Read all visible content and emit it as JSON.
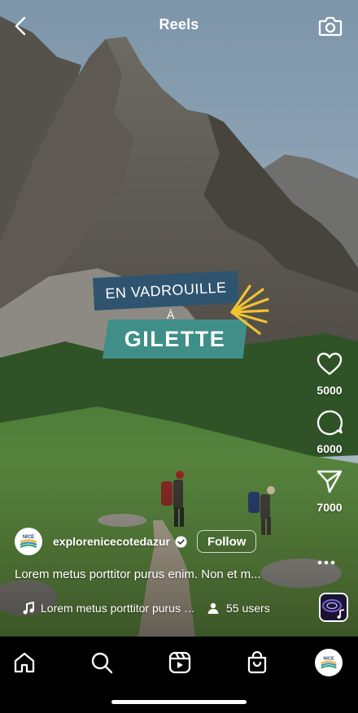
{
  "header": {
    "title": "Reels",
    "back_icon": "chevron-left-icon",
    "camera_icon": "camera-icon"
  },
  "banner": {
    "line1": "EN VADROUILLE",
    "line2": "À",
    "line3": "GILETTE",
    "colors": {
      "top": "#2f5470",
      "bottom": "#3f8f88",
      "sun": "#f2c230"
    }
  },
  "actions": {
    "likes": "5000",
    "comments": "6000",
    "shares": "7000"
  },
  "author": {
    "username": "explorenicecotedazur",
    "follow_label": "Follow",
    "avatar_text": "NICE"
  },
  "caption": "Lorem metus porttitor purus enim. Non et m...",
  "audio": {
    "label": "Lorem metus porttitor purus enim. Non et m...",
    "users": "55 users"
  },
  "nav": {
    "items": [
      "home-icon",
      "search-icon",
      "reels-icon",
      "shop-icon",
      "profile-avatar"
    ]
  }
}
